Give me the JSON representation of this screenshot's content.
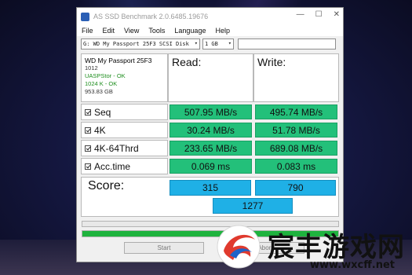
{
  "window": {
    "title": "AS SSD Benchmark 2.0.6485.19676",
    "minimize": "—",
    "maximize": "☐",
    "close": "✕"
  },
  "menu": [
    "File",
    "Edit",
    "View",
    "Tools",
    "Language",
    "Help"
  ],
  "toolbar": {
    "drive_select": "G: WD My Passport 25F3 SCSI Disk",
    "size_select": "1 GB",
    "extra_field": ""
  },
  "drive_info": {
    "name": "WD My Passport 25F3",
    "firmware": "1012",
    "driver_status": "UASPStor - OK",
    "alignment_status": "1024 K - OK",
    "capacity": "953.83 GB"
  },
  "columns": {
    "read": "Read:",
    "write": "Write:"
  },
  "tests": [
    {
      "label": "Seq",
      "read": "507.95 MB/s",
      "write": "495.74 MB/s"
    },
    {
      "label": "4K",
      "read": "30.24 MB/s",
      "write": "51.78 MB/s"
    },
    {
      "label": "4K-64Thrd",
      "read": "233.65 MB/s",
      "write": "689.08 MB/s"
    },
    {
      "label": "Acc.time",
      "read": "0.069 ms",
      "write": "0.083 ms"
    }
  ],
  "score": {
    "label": "Score:",
    "read": "315",
    "write": "790",
    "total": "1277"
  },
  "progress": {
    "test_progress": 0,
    "total_progress": 1.0
  },
  "buttons": {
    "start": "Start",
    "abort": "Abort"
  },
  "watermark": {
    "title": "宸丰游戏网",
    "url": "www.wxcff.net"
  },
  "colors": {
    "result_green": "#23c07a",
    "score_blue": "#1fb0e6",
    "progress_green": "#1fb33e"
  }
}
